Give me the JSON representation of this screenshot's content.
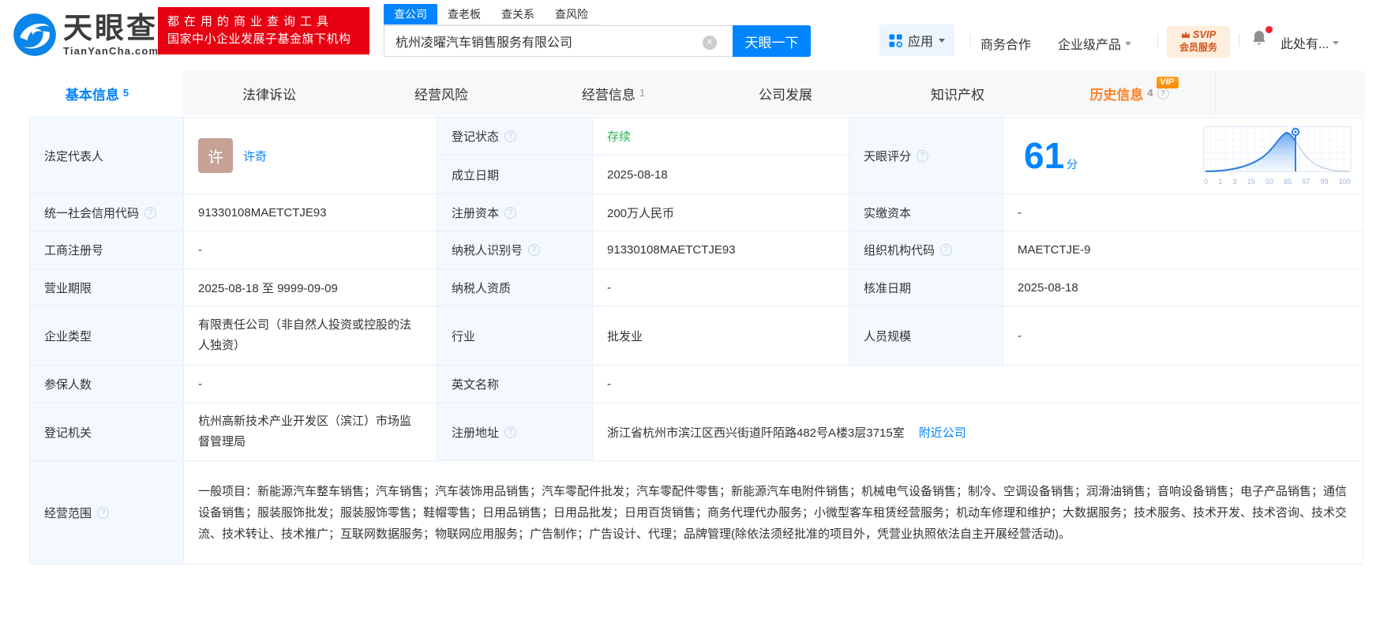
{
  "brand": {
    "name": "天眼查",
    "domain": "TianYanCha.com",
    "slogan_line1": "都在用的商业查询工具",
    "slogan_line2": "国家中小企业发展子基金旗下机构"
  },
  "search": {
    "tab_company": "查公司",
    "tab_boss": "查老板",
    "tab_relation": "查关系",
    "tab_risk": "查风险",
    "input_value": "杭州凌曜汽车销售服务有限公司",
    "clear_glyph": "✕",
    "button_label": "天眼一下"
  },
  "header_nav": {
    "apps_label": "应用",
    "coop_label": "商务合作",
    "enterprise_label": "企业级产品",
    "svip_line1": "SVIP",
    "svip_line2": "会员服务",
    "user_label": "此处有..."
  },
  "nav_tabs": {
    "basic": {
      "label": "基本信息",
      "count": "5"
    },
    "legal": {
      "label": "法律诉讼"
    },
    "risk": {
      "label": "经营风险"
    },
    "operation": {
      "label": "经营信息",
      "count": "1"
    },
    "development": {
      "label": "公司发展"
    },
    "ip": {
      "label": "知识产权"
    },
    "history": {
      "label": "历史信息",
      "count": "4",
      "vip": "VIP"
    }
  },
  "info": {
    "legal_rep": {
      "label": "法定代表人",
      "avatar_char": "许",
      "name": "许奇"
    },
    "reg_status": {
      "label": "登记状态",
      "value": "存续"
    },
    "est_date": {
      "label": "成立日期",
      "value": "2025-08-18"
    },
    "score": {
      "label": "天眼评分",
      "value": "61",
      "unit": "分",
      "axis_labels": [
        "0",
        "1",
        "3",
        "15",
        "50",
        "85",
        "97",
        "99",
        "100"
      ]
    },
    "uscc": {
      "label": "统一社会信用代码",
      "value": "91330108MAETCTJE93"
    },
    "reg_capital": {
      "label": "注册资本",
      "value": "200万人民币"
    },
    "paid_capital": {
      "label": "实缴资本",
      "value": "-"
    },
    "biz_reg_no": {
      "label": "工商注册号",
      "value": "-"
    },
    "taxpayer_id": {
      "label": "纳税人识别号",
      "value": "91330108MAETCTJE93"
    },
    "org_code": {
      "label": "组织机构代码",
      "value": "MAETCTJE-9"
    },
    "biz_term": {
      "label": "营业期限",
      "value": "2025-08-18 至 9999-09-09"
    },
    "taxpayer_qual": {
      "label": "纳税人资质",
      "value": "-"
    },
    "approval_date": {
      "label": "核准日期",
      "value": "2025-08-18"
    },
    "company_type": {
      "label": "企业类型",
      "value": "有限责任公司（非自然人投资或控股的法人独资）"
    },
    "industry": {
      "label": "行业",
      "value": "批发业"
    },
    "staff_size": {
      "label": "人员规模",
      "value": "-"
    },
    "insured_count": {
      "label": "参保人数",
      "value": "-"
    },
    "english_name": {
      "label": "英文名称",
      "value": "-"
    },
    "reg_authority": {
      "label": "登记机关",
      "value": "杭州高新技术产业开发区（滨江）市场监督管理局"
    },
    "reg_address": {
      "label": "注册地址",
      "value": "浙江省杭州市滨江区西兴街道阡陌路482号A楼3层3715室",
      "nearby_link": "附近公司"
    },
    "biz_scope": {
      "label": "经营范围",
      "value": "一般项目：新能源汽车整车销售；汽车销售；汽车装饰用品销售；汽车零配件批发；汽车零配件零售；新能源汽车电附件销售；机械电气设备销售；制冷、空调设备销售；润滑油销售；音响设备销售；电子产品销售；通信设备销售；服装服饰批发；服装服饰零售；鞋帽零售；日用品销售；日用品批发；日用百货销售；商务代理代办服务；小微型客车租赁经营服务；机动车修理和维护；大数据服务；技术服务、技术开发、技术咨询、技术交流、技术转让、技术推广；互联网数据服务；物联网应用服务；广告制作；广告设计、代理；品牌管理(除依法须经批准的项目外，凭营业执照依法自主开展经营活动)。"
    }
  },
  "colors": {
    "primary_blue": "#0084ff",
    "brand_red": "#e60012",
    "status_green": "#2bb24c",
    "history_orange": "#ff8125",
    "label_bg": "#f3f9fe"
  }
}
